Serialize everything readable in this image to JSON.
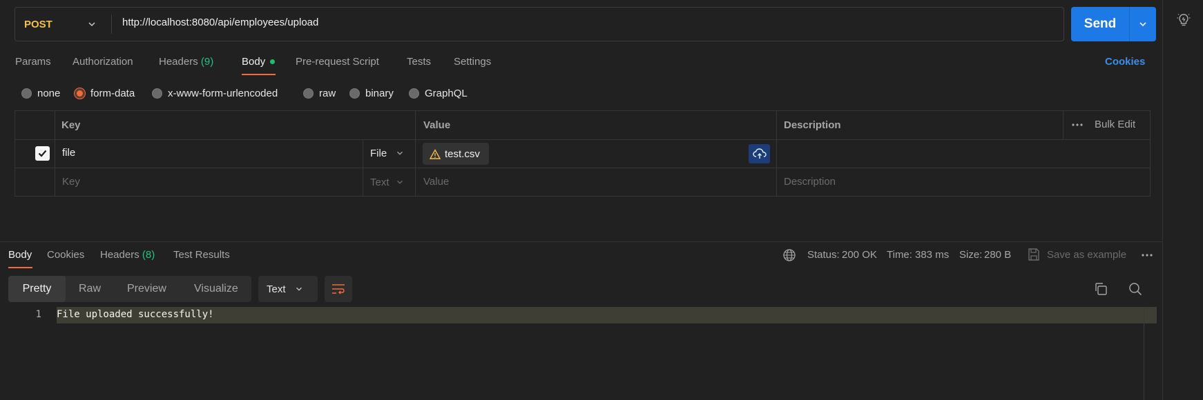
{
  "request": {
    "method": "POST",
    "url": "http://localhost:8080/api/employees/upload",
    "send_label": "Send"
  },
  "tabs": {
    "params": "Params",
    "authorization": "Authorization",
    "headers": "Headers",
    "headers_count": "(9)",
    "body": "Body",
    "prerequest": "Pre-request Script",
    "tests": "Tests",
    "settings": "Settings",
    "cookies": "Cookies",
    "active": "Body"
  },
  "body_types": {
    "options": [
      "none",
      "form-data",
      "x-www-form-urlencoded",
      "raw",
      "binary",
      "GraphQL"
    ],
    "selected": "form-data"
  },
  "form_table": {
    "headers": {
      "key": "Key",
      "value": "Value",
      "description": "Description",
      "bulk_edit": "Bulk Edit"
    },
    "rows": [
      {
        "checked": true,
        "key": "file",
        "type": "File",
        "value": "test.csv",
        "description": ""
      }
    ],
    "placeholder_row": {
      "key": "Key",
      "type": "Text",
      "value": "Value",
      "description": "Description"
    }
  },
  "response": {
    "tabs": {
      "body": "Body",
      "cookies": "Cookies",
      "headers": "Headers",
      "headers_count": "(8)",
      "test_results": "Test Results"
    },
    "status_label": "Status:",
    "status_value": "200 OK",
    "time_label": "Time:",
    "time_value": "383 ms",
    "size_label": "Size:",
    "size_value": "280 B",
    "save_example": "Save as example",
    "views": {
      "pretty": "Pretty",
      "raw": "Raw",
      "preview": "Preview",
      "visualize": "Visualize"
    },
    "format": "Text",
    "lines": [
      {
        "number": "1",
        "text": "File uploaded successfully!"
      }
    ]
  },
  "colors": {
    "method": "#f5c04e",
    "send": "#1c79e6",
    "accent": "#f26b3a",
    "success": "#26c281",
    "link": "#3b8fe8"
  }
}
